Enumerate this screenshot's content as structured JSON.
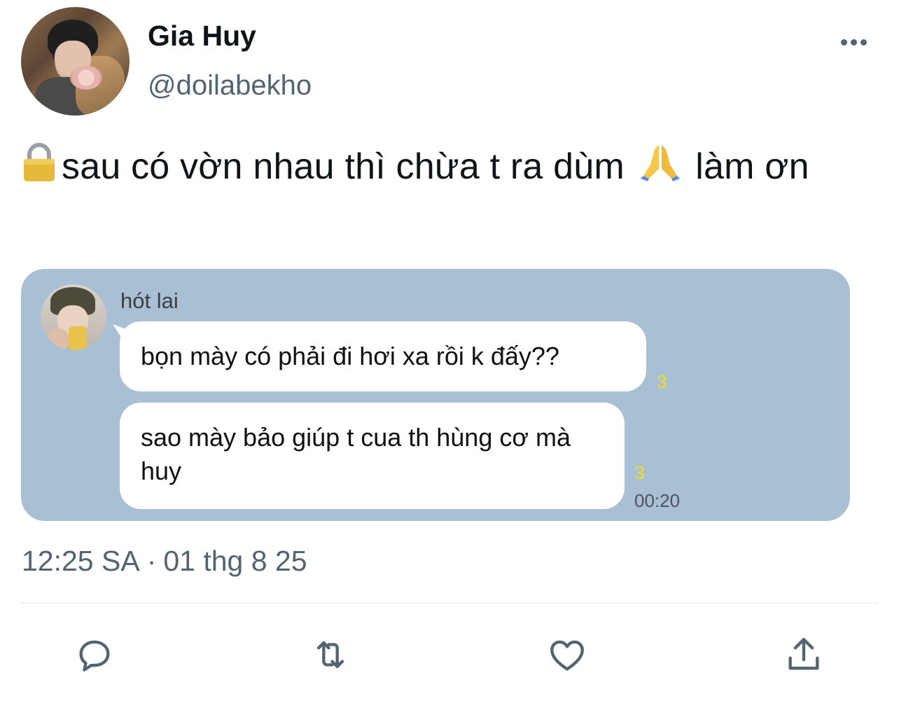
{
  "author": {
    "display_name": "Gia Huy",
    "handle": "@doilabekho"
  },
  "tweet": {
    "lock_emoji": "🔒",
    "text_part1": "sau có vờn nhau thì chừa t ra dùm",
    "pray_emoji": "🙏",
    "text_part2": "làm ơn",
    "timestamp_time": "12:25 SA",
    "timestamp_sep": "·",
    "timestamp_date": "01 thg 8 25"
  },
  "media": {
    "background_color": "#a9bfd4",
    "chat": {
      "sender_name": "hót lai",
      "messages": [
        {
          "text": "bọn mày có phải đi hơi xa rồi k đấy??",
          "read_count": "3"
        },
        {
          "text": "sao mày bảo giúp t cua th hùng cơ mà huy",
          "read_count": "3",
          "time": "00:20"
        }
      ]
    }
  },
  "actions": {
    "reply": "reply-icon",
    "retweet": "retweet-icon",
    "like": "heart-icon",
    "share": "share-icon"
  },
  "colors": {
    "text_primary": "#0f1419",
    "text_secondary": "#536471",
    "read_indicator": "#f2e01a",
    "divider": "#eff3f4"
  }
}
